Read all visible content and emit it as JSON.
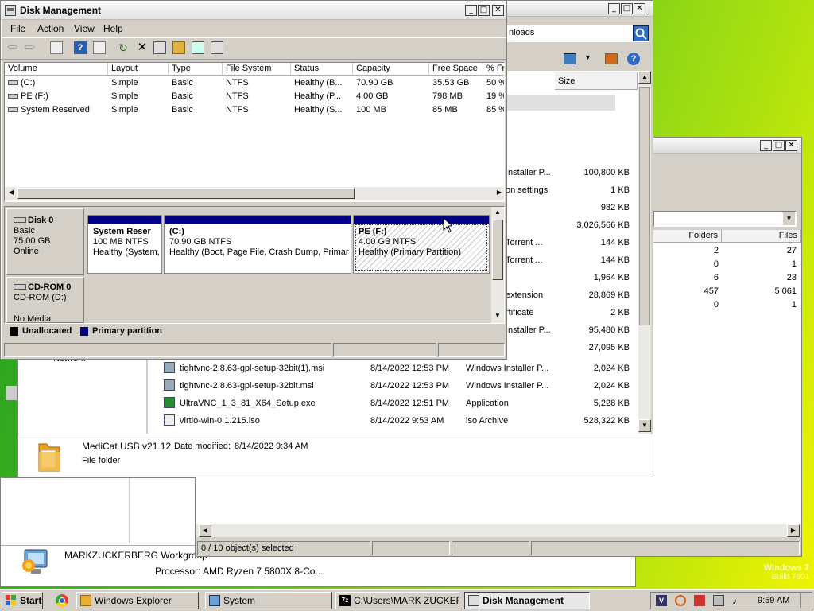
{
  "desktop": {
    "watermark_line1": "Windows 7",
    "watermark_line2": "Build 7601"
  },
  "explorer": {
    "search_value": "nloads",
    "size_header": "Size",
    "rows": [
      {
        "type": "Installer P...",
        "size": "100,800 KB"
      },
      {
        "type": "on settings",
        "size": "1 KB"
      },
      {
        "type": "",
        "size": "982 KB"
      },
      {
        "type": "",
        "size": "3,026,566 KB"
      },
      {
        "type": "Torrent ...",
        "size": "144 KB"
      },
      {
        "type": "Torrent ...",
        "size": "144 KB"
      },
      {
        "type": "",
        "size": "1,964 KB"
      },
      {
        "type": "extension",
        "size": "28,869 KB"
      },
      {
        "type": "rtificate",
        "size": "2 KB"
      },
      {
        "type": "Installer P...",
        "size": "95,480 KB"
      },
      {
        "type": "",
        "size": "27,095 KB"
      }
    ],
    "full_rows": [
      {
        "name": "tightvnc-2.8.63-gpl-setup-32bit(1).msi",
        "date": "8/14/2022 12:53 PM",
        "type": "Windows Installer P...",
        "size": "2,024 KB"
      },
      {
        "name": "tightvnc-2.8.63-gpl-setup-32bit.msi",
        "date": "8/14/2022 12:53 PM",
        "type": "Windows Installer P...",
        "size": "2,024 KB"
      },
      {
        "name": "UltraVNC_1_3_81_X64_Setup.exe",
        "date": "8/14/2022 12:51 PM",
        "type": "Application",
        "size": "5,228 KB"
      },
      {
        "name": "virtio-win-0.1.215.iso",
        "date": "8/14/2022 9:53 AM",
        "type": "iso Archive",
        "size": "528,322 KB"
      }
    ],
    "details_name": "MediCat USB v21.12",
    "details_modified_label": "Date modified:",
    "details_modified": "8/14/2022 9:34 AM",
    "details_type": "File folder",
    "nav_network": "Network"
  },
  "folders_window": {
    "col_folders": "Folders",
    "col_files": "Files",
    "rows": [
      {
        "folders": "2",
        "files": "27"
      },
      {
        "folders": "0",
        "files": "1"
      },
      {
        "folders": "6",
        "files": "23"
      },
      {
        "folders": "457",
        "files": "5 061"
      },
      {
        "folders": "0",
        "files": "1"
      }
    ],
    "status": "0 / 10 object(s) selected"
  },
  "system_window": {
    "computer": "MARKZUCKERBERG",
    "workgroup": "Workgroup",
    "processor_label": "Processor:",
    "processor": "AMD Ryzen 7 5800X 8-Co..."
  },
  "disk_mgmt": {
    "title": "Disk Management",
    "menu": [
      "File",
      "Action",
      "View",
      "Help"
    ],
    "columns": [
      "Volume",
      "Layout",
      "Type",
      "File System",
      "Status",
      "Capacity",
      "Free Space",
      "% Fr"
    ],
    "volumes": [
      {
        "volume": "(C:)",
        "layout": "Simple",
        "type": "Basic",
        "fs": "NTFS",
        "status": "Healthy (B...",
        "capacity": "70.90 GB",
        "free": "35.53 GB",
        "pct": "50 %"
      },
      {
        "volume": "PE (F:)",
        "layout": "Simple",
        "type": "Basic",
        "fs": "NTFS",
        "status": "Healthy (P...",
        "capacity": "4.00 GB",
        "free": "798 MB",
        "pct": "19 %"
      },
      {
        "volume": "System Reserved",
        "layout": "Simple",
        "type": "Basic",
        "fs": "NTFS",
        "status": "Healthy (S...",
        "capacity": "100 MB",
        "free": "85 MB",
        "pct": "85 %"
      }
    ],
    "disk0": {
      "name": "Disk 0",
      "type": "Basic",
      "size": "75.00 GB",
      "state": "Online"
    },
    "partitions": [
      {
        "name": "System Reser",
        "size": "100 MB NTFS",
        "status": "Healthy (System,"
      },
      {
        "name": "(C:)",
        "size": "70.90 GB NTFS",
        "status": "Healthy (Boot, Page File, Crash Dump, Primary"
      },
      {
        "name": "PE  (F:)",
        "size": "4.00 GB NTFS",
        "status": "Healthy (Primary Partition)"
      }
    ],
    "cdrom": {
      "name": "CD-ROM 0",
      "drive": "CD-ROM (D:)",
      "media": "No Media"
    },
    "legend": [
      "Unallocated",
      "Primary partition"
    ]
  },
  "taskbar": {
    "start": "Start",
    "tasks": [
      "Windows Explorer",
      "System",
      "C:\\Users\\MARK ZUCKER...",
      "Disk Management"
    ],
    "clock": "9:59 AM"
  },
  "colors": {
    "partition_header": "#000080",
    "titlebar_grad": "#e8e8e8"
  }
}
